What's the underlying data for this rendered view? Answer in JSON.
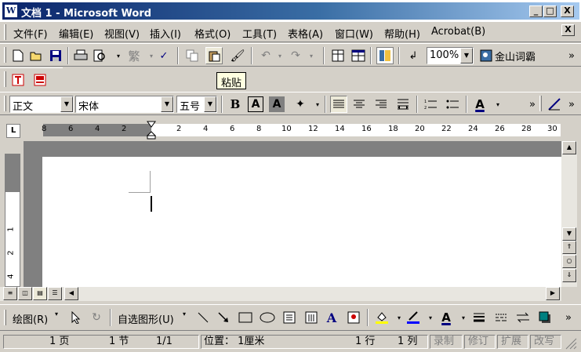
{
  "window": {
    "icon_letter": "W",
    "title": "文档 1 - Microsoft Word"
  },
  "caption_buttons": {
    "minimize": "_",
    "maximize": "□",
    "close": "X"
  },
  "menu": {
    "items": [
      "文件(F)",
      "编辑(E)",
      "视图(V)",
      "插入(I)",
      "格式(O)",
      "工具(T)",
      "表格(A)",
      "窗口(W)",
      "帮助(H)",
      "Acrobat(B)"
    ],
    "close_label": "X"
  },
  "standard_toolbar": {
    "zoom": "100%",
    "dictionary_label": "金山词霸",
    "traditional_char": "繁"
  },
  "tooltip": {
    "text": "粘贴"
  },
  "format_toolbar": {
    "style": "正文",
    "font": "宋体",
    "size": "五号",
    "bold": "B",
    "char_border": "A",
    "char_shade": "A",
    "font_color": "A"
  },
  "ruler": {
    "left_numbers": [
      "8",
      "6",
      "4",
      "2"
    ],
    "right_numbers": [
      "2",
      "4",
      "6",
      "8",
      "10",
      "12",
      "14",
      "16",
      "18",
      "20",
      "22",
      "24",
      "26",
      "28",
      "30"
    ],
    "tab_selector": "L"
  },
  "vertical_ruler": {
    "numbers": [
      "1",
      "2",
      "4"
    ]
  },
  "drawing_toolbar": {
    "draw_label": "绘图(R)",
    "autoshapes_label": "自选图形(U)"
  },
  "status_bar": {
    "page": "1 页",
    "section": "1 节",
    "page_of": "1/1",
    "position": "位置：  1厘米",
    "line": "1 行",
    "column": "1 列",
    "rec": "录制",
    "trk": "修订",
    "ext": "扩展",
    "ovr": "改写"
  }
}
